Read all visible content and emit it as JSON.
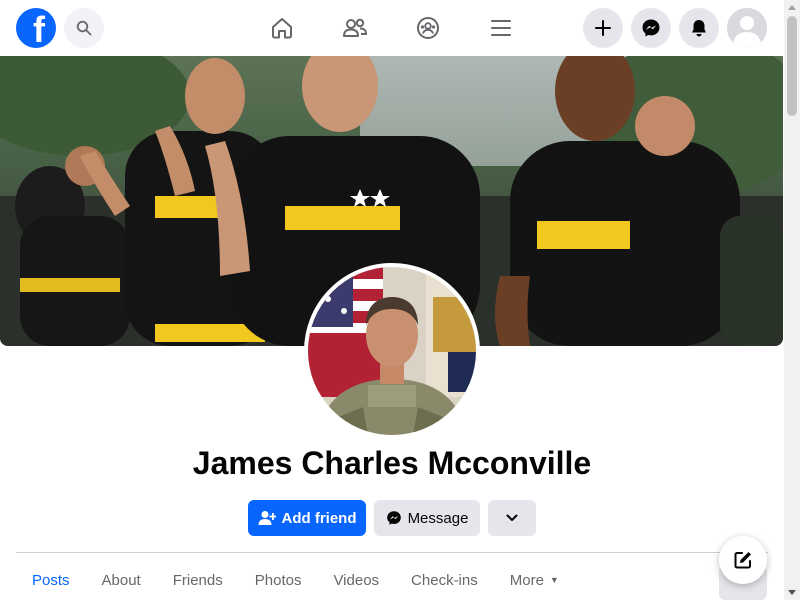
{
  "nav": {
    "logo_letter": "f",
    "icons": [
      "facebook-logo",
      "search-icon",
      "home-icon",
      "friends-icon",
      "groups-icon",
      "menu-icon",
      "plus-icon",
      "messenger-icon",
      "bell-icon",
      "account-avatar"
    ]
  },
  "profile": {
    "name": "James Charles Mcconville"
  },
  "actions": {
    "add_friend": "Add friend",
    "message": "Message"
  },
  "tabs": [
    {
      "label": "Posts",
      "active": true
    },
    {
      "label": "About",
      "active": false
    },
    {
      "label": "Friends",
      "active": false
    },
    {
      "label": "Photos",
      "active": false
    },
    {
      "label": "Videos",
      "active": false
    },
    {
      "label": "Check-ins",
      "active": false
    },
    {
      "label": "More",
      "active": false
    }
  ],
  "colors": {
    "brand_blue": "#0866ff",
    "secondary_button": "#e4e6eb",
    "tab_text": "#65676b",
    "page_background": "#ffffff"
  }
}
